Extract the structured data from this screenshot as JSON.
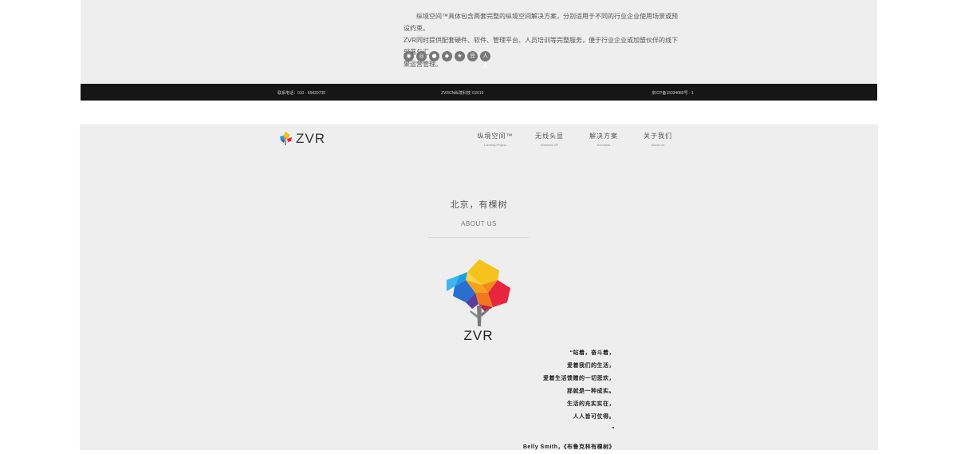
{
  "intro": {
    "lines": [
      "　　纵境空间™具体包含两套完整的纵境空间解决方案，分别适用于不同的行业企业使用场景或预设约束。",
      "ZVR同时提供配套硬件、软件、管理平台、人员培训等完整服务，便于行业企业或加盟伙伴的线下部署与汇",
      "聚运营管理。"
    ]
  },
  "social": [
    {
      "name": "weibo",
      "glyph": "◉"
    },
    {
      "name": "dribbble",
      "glyph": "◎"
    },
    {
      "name": "qq",
      "glyph": "●"
    },
    {
      "name": "wechat",
      "glyph": "◆"
    },
    {
      "name": "star",
      "glyph": "★"
    },
    {
      "name": "douban",
      "glyph": "豆"
    },
    {
      "name": "renren",
      "glyph": "人人"
    }
  ],
  "footer": {
    "left": "联系电话：010 - 65620735",
    "center": "ZVRCN纵境科技 ©2015",
    "right": "京ICP备15034080号 - 1"
  },
  "header": {
    "brand": "ZVR",
    "nav": [
      {
        "cn": "纵境空间™",
        "en": "Landing Project"
      },
      {
        "cn": "无线头显",
        "en": "Wireless VR"
      },
      {
        "cn": "解决方案",
        "en": "Solutions"
      },
      {
        "cn": "关于我们",
        "en": "About Us"
      }
    ]
  },
  "about": {
    "title": "北京，有棵树",
    "subtitle": "ABOUT US",
    "brand": "ZVR"
  },
  "quote": {
    "lines": [
      "“站着，奋斗着，",
      "爱着我们的生活，",
      "爱着生活馈赠的一切悲欢，",
      "那就是一种成实。",
      "生活的充实实在，",
      "人人皆可仗得。",
      "”"
    ],
    "author": "Belly Smith，《布鲁克林有棵树》"
  },
  "colors": {
    "panel_bg": "#eeeeee",
    "footer_bg": "#161616",
    "tree_yellow": "#f6c21c",
    "tree_orange": "#f08a1d",
    "tree_red": "#e8253d",
    "tree_blue": "#1b9ce6",
    "tree_purple": "#5b3fa0"
  }
}
